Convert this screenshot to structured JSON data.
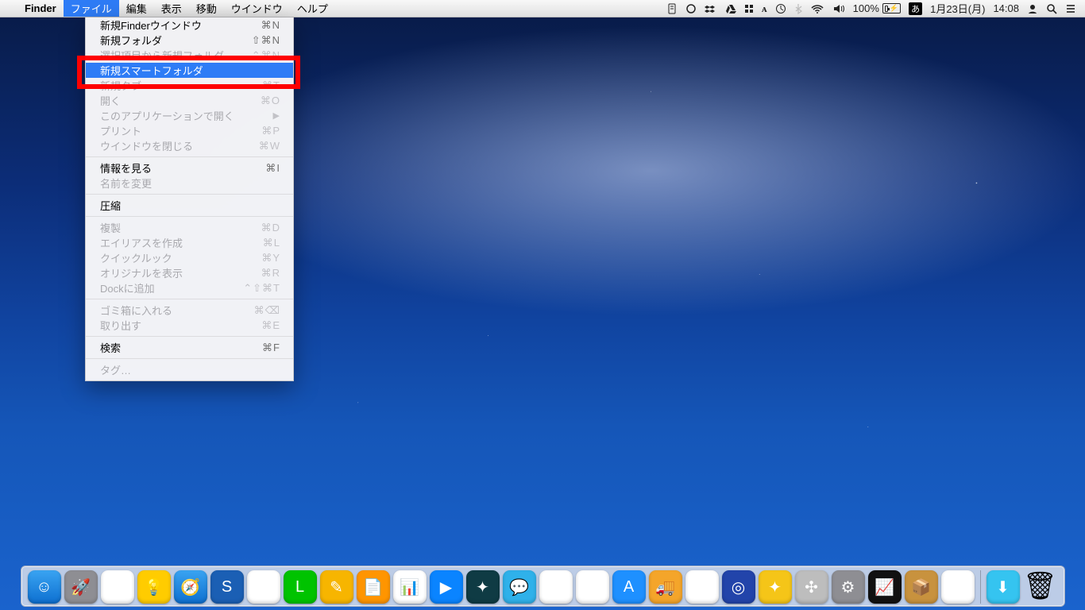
{
  "menubar": {
    "apple": "",
    "app": "Finder",
    "items": [
      "ファイル",
      "編集",
      "表示",
      "移動",
      "ウインドウ",
      "ヘルプ"
    ],
    "active_index": 0,
    "status": {
      "battery_text": "100%",
      "ime": "あ",
      "date": "1月23日(月)",
      "time": "14:08"
    }
  },
  "menu": {
    "groups": [
      [
        {
          "label": "新規Finderウインドウ",
          "shortcut": "⌘N",
          "enabled": true,
          "highlight": false
        },
        {
          "label": "新規フォルダ",
          "shortcut": "⇧⌘N",
          "enabled": true,
          "highlight": false
        },
        {
          "label": "選択項目から新規フォルダ",
          "shortcut": "⌃⌘N",
          "enabled": false,
          "highlight": false
        },
        {
          "label": "新規スマートフォルダ",
          "shortcut": "",
          "enabled": true,
          "highlight": true
        },
        {
          "label": "新規タブ",
          "shortcut": "⌘T",
          "enabled": false,
          "highlight": false
        },
        {
          "label": "開く",
          "shortcut": "⌘O",
          "enabled": false,
          "highlight": false
        },
        {
          "label": "このアプリケーションで開く",
          "shortcut": "",
          "enabled": false,
          "highlight": false,
          "submenu": true
        },
        {
          "label": "プリント",
          "shortcut": "⌘P",
          "enabled": false,
          "highlight": false
        },
        {
          "label": "ウインドウを閉じる",
          "shortcut": "⌘W",
          "enabled": false,
          "highlight": false
        }
      ],
      [
        {
          "label": "情報を見る",
          "shortcut": "⌘I",
          "enabled": true,
          "highlight": false
        },
        {
          "label": "名前を変更",
          "shortcut": "",
          "enabled": false,
          "highlight": false
        }
      ],
      [
        {
          "label": "圧縮",
          "shortcut": "",
          "enabled": true,
          "highlight": false
        }
      ],
      [
        {
          "label": "複製",
          "shortcut": "⌘D",
          "enabled": false,
          "highlight": false
        },
        {
          "label": "エイリアスを作成",
          "shortcut": "⌘L",
          "enabled": false,
          "highlight": false
        },
        {
          "label": "クイックルック",
          "shortcut": "⌘Y",
          "enabled": false,
          "highlight": false
        },
        {
          "label": "オリジナルを表示",
          "shortcut": "⌘R",
          "enabled": false,
          "highlight": false
        },
        {
          "label": "Dockに追加",
          "shortcut": "⌃⇧⌘T",
          "enabled": false,
          "highlight": false
        }
      ],
      [
        {
          "label": "ゴミ箱に入れる",
          "shortcut": "⌘⌫",
          "enabled": false,
          "highlight": false
        },
        {
          "label": "取り出す",
          "shortcut": "⌘E",
          "enabled": false,
          "highlight": false
        }
      ],
      [
        {
          "label": "検索",
          "shortcut": "⌘F",
          "enabled": true,
          "highlight": false
        }
      ],
      [
        {
          "label": "タグ…",
          "shortcut": "",
          "enabled": false,
          "highlight": false
        }
      ]
    ]
  },
  "dock": {
    "apps": [
      {
        "name": "finder",
        "bg": "linear-gradient(#3aa4f2,#0d6fd0)",
        "glyph": "☺"
      },
      {
        "name": "launchpad",
        "bg": "#8e8e93",
        "glyph": "🚀"
      },
      {
        "name": "chrome",
        "bg": "#fff",
        "glyph": "◉"
      },
      {
        "name": "tips",
        "bg": "#ffcc00",
        "glyph": "💡"
      },
      {
        "name": "safari",
        "bg": "linear-gradient(#3aa4f2,#0d6fd0)",
        "glyph": "🧭"
      },
      {
        "name": "app-blue-s",
        "bg": "#1b5fb4",
        "glyph": "S"
      },
      {
        "name": "mail",
        "bg": "#fff",
        "glyph": "✉"
      },
      {
        "name": "line",
        "bg": "#00c300",
        "glyph": "L"
      },
      {
        "name": "app-yellow",
        "bg": "#f7b500",
        "glyph": "✎"
      },
      {
        "name": "pages",
        "bg": "#ff9500",
        "glyph": "📄"
      },
      {
        "name": "numbers",
        "bg": "#fff",
        "glyph": "📊"
      },
      {
        "name": "keynote",
        "bg": "#0a84ff",
        "glyph": "▶"
      },
      {
        "name": "app-teal",
        "bg": "#0f3b44",
        "glyph": "✦"
      },
      {
        "name": "messages",
        "bg": "#2fb1ea",
        "glyph": "💬"
      },
      {
        "name": "photos",
        "bg": "#fff",
        "glyph": "✿"
      },
      {
        "name": "itunes",
        "bg": "#fff",
        "glyph": "♪"
      },
      {
        "name": "appstore",
        "bg": "#1e90ff",
        "glyph": "A"
      },
      {
        "name": "app-truck",
        "bg": "#f4a52a",
        "glyph": "🚚"
      },
      {
        "name": "ms",
        "bg": "#fff",
        "glyph": "⊞"
      },
      {
        "name": "app-scan",
        "bg": "#2244aa",
        "glyph": "◎"
      },
      {
        "name": "app-yellow2",
        "bg": "#f5c518",
        "glyph": "✦"
      },
      {
        "name": "app-gear",
        "bg": "#bdbdbd",
        "glyph": "✣"
      },
      {
        "name": "sysprefs",
        "bg": "#8e8e93",
        "glyph": "⚙"
      },
      {
        "name": "activity",
        "bg": "#111",
        "glyph": "📈"
      },
      {
        "name": "app-box",
        "bg": "#c8923e",
        "glyph": "📦"
      },
      {
        "name": "app-bars",
        "bg": "#fff",
        "glyph": "▮"
      }
    ],
    "right": [
      {
        "name": "downloads",
        "bg": "#35c4f0",
        "glyph": "⬇"
      },
      {
        "name": "trash",
        "glyph": "🗑"
      }
    ]
  }
}
